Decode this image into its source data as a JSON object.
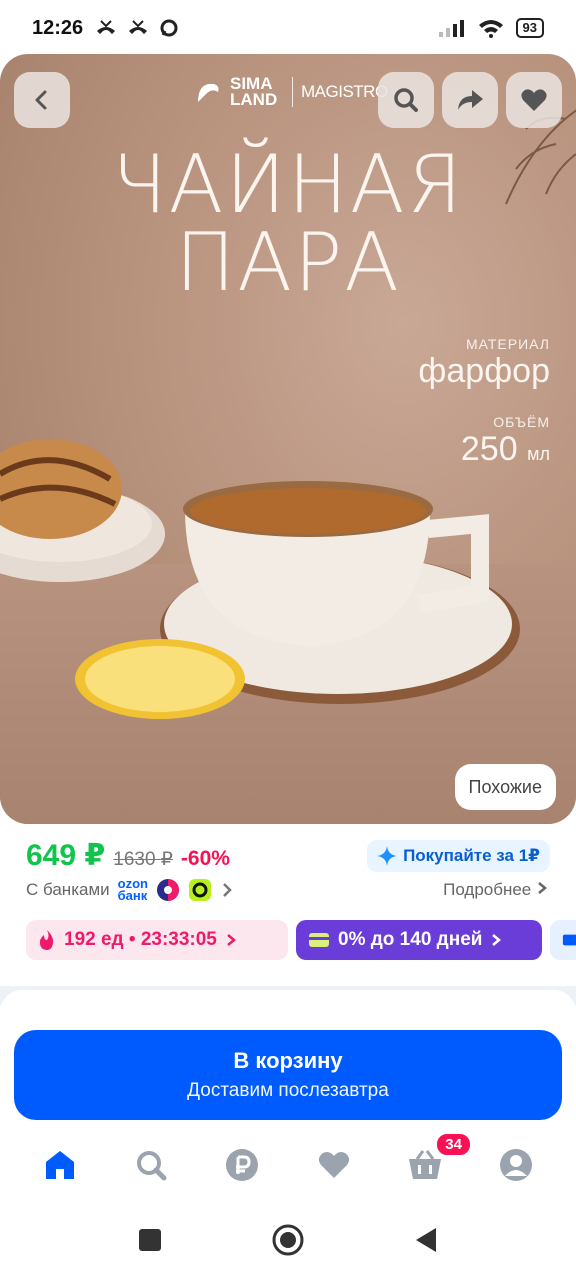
{
  "status_bar": {
    "time": "12:26",
    "battery": "93"
  },
  "hero": {
    "brand_primary": "SIMA LAND",
    "brand_secondary": "MAGISTRO",
    "headline_line1": "ЧАЙНАЯ",
    "headline_line2": "ПАРА",
    "material_label": "МАТЕРИАЛ",
    "material_value": "фарфор",
    "volume_label": "ОБЪЁМ",
    "volume_value": "250",
    "volume_unit": "мл",
    "similar_label": "Похожие"
  },
  "price": {
    "current": "649 ₽",
    "old": "1630 ₽",
    "discount": "-60%",
    "promo": "Покупайте за 1₽",
    "banks_label": "С банками",
    "ozon_bank_line1": "ozon",
    "ozon_bank_line2": "банк",
    "more_link": "Подробнее"
  },
  "chips": {
    "timer": "192 ед • 23:33:05",
    "installment": "0% до 140 дней"
  },
  "cart": {
    "title": "В корзину",
    "subtitle": "Доставим послезавтра"
  },
  "bottom_nav": {
    "items": [
      "home-icon",
      "search-icon",
      "ruble-icon",
      "heart-icon",
      "cart-icon",
      "profile-icon"
    ],
    "cart_badge": "34",
    "active_color": "#005bff",
    "inactive_color": "#9aa3ae"
  },
  "colors": {
    "brand_blue": "#005bff",
    "price_green": "#10c44c",
    "discount_pink": "#f91155",
    "installment_purple": "#6a3cd8"
  }
}
